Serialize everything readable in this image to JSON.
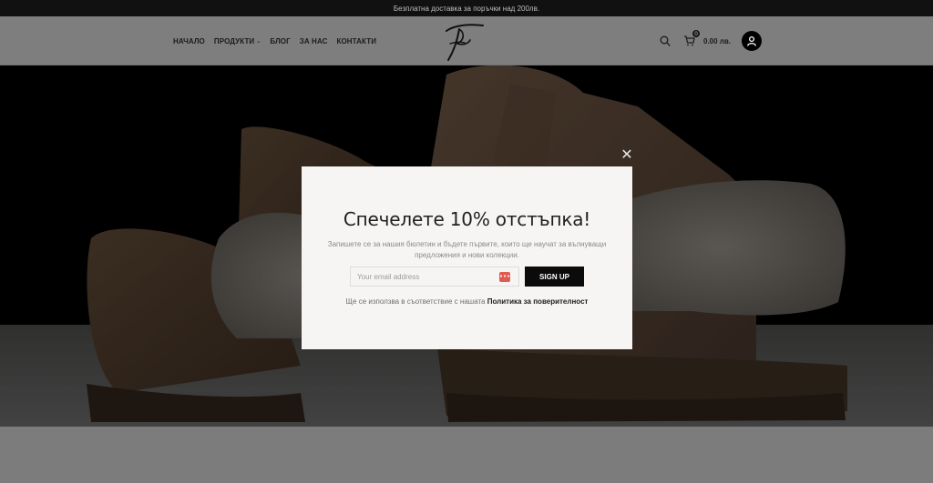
{
  "topbar": {
    "text": "Безплатна доставка за поръчки над 200лв."
  },
  "nav": {
    "items": [
      {
        "label": "НАЧАЛО",
        "has_dropdown": false
      },
      {
        "label": "ПРОДУКТИ",
        "has_dropdown": true
      },
      {
        "label": "БЛОГ",
        "has_dropdown": false
      },
      {
        "label": "ЗА НАС",
        "has_dropdown": false
      },
      {
        "label": "КОНТАКТИ",
        "has_dropdown": false
      }
    ]
  },
  "header_icons": {
    "search": "search-icon",
    "cart": "cart-icon",
    "account": "user-icon",
    "cart_count": "0",
    "cart_total": "0.00 лв."
  },
  "popup": {
    "close_icon": "close-icon",
    "title": "Спечелете 10% отстъпка!",
    "text": "Запишете се за нашия бюлетин и бъдете първите, които ще научат за вълнуващи предложения и нови колекции.",
    "email_placeholder": "Your email address",
    "email_value": "",
    "signup_label": "SIGN UP",
    "consent_text": "Ще се използва в съответствие с нашата",
    "consent_link": "Политика за поверителност"
  },
  "colors": {
    "modal_bg": "#f6f5f3",
    "button_bg": "#0b0b0b",
    "password_icon": "#e05a4f"
  }
}
